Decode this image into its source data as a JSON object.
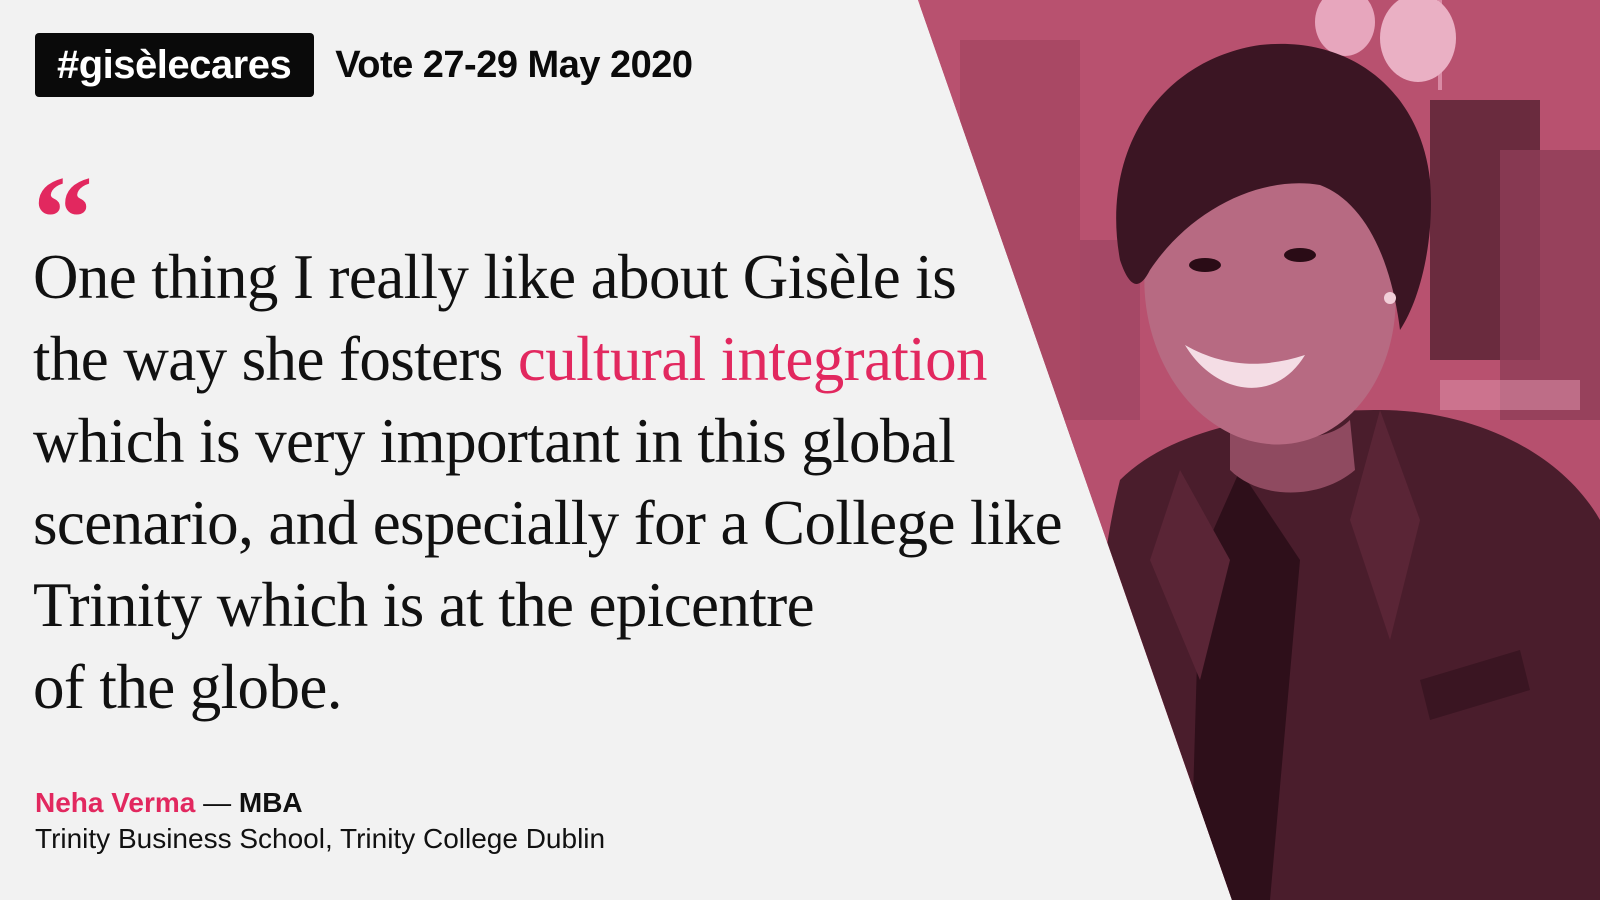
{
  "header": {
    "hashtag": "#gisèlecares",
    "vote_date": "Vote 27-29 May 2020"
  },
  "quote": {
    "open_mark": "“",
    "lines": [
      "One thing I really like about Gisèle is",
      "the way she fosters ",
      "cultural integration",
      "which is very important in this global",
      "scenario, and especially for a College like",
      "Trinity which is at the epicentre",
      "of the globe."
    ]
  },
  "attribution": {
    "name": "Neha Verma",
    "separator": " — ",
    "program": "MBA",
    "institution": "Trinity Business School, Trinity College Dublin"
  },
  "colors": {
    "accent": "#e2285f",
    "photo_tint": "#c9607f",
    "background": "#f2f2f2",
    "text": "#111111"
  }
}
